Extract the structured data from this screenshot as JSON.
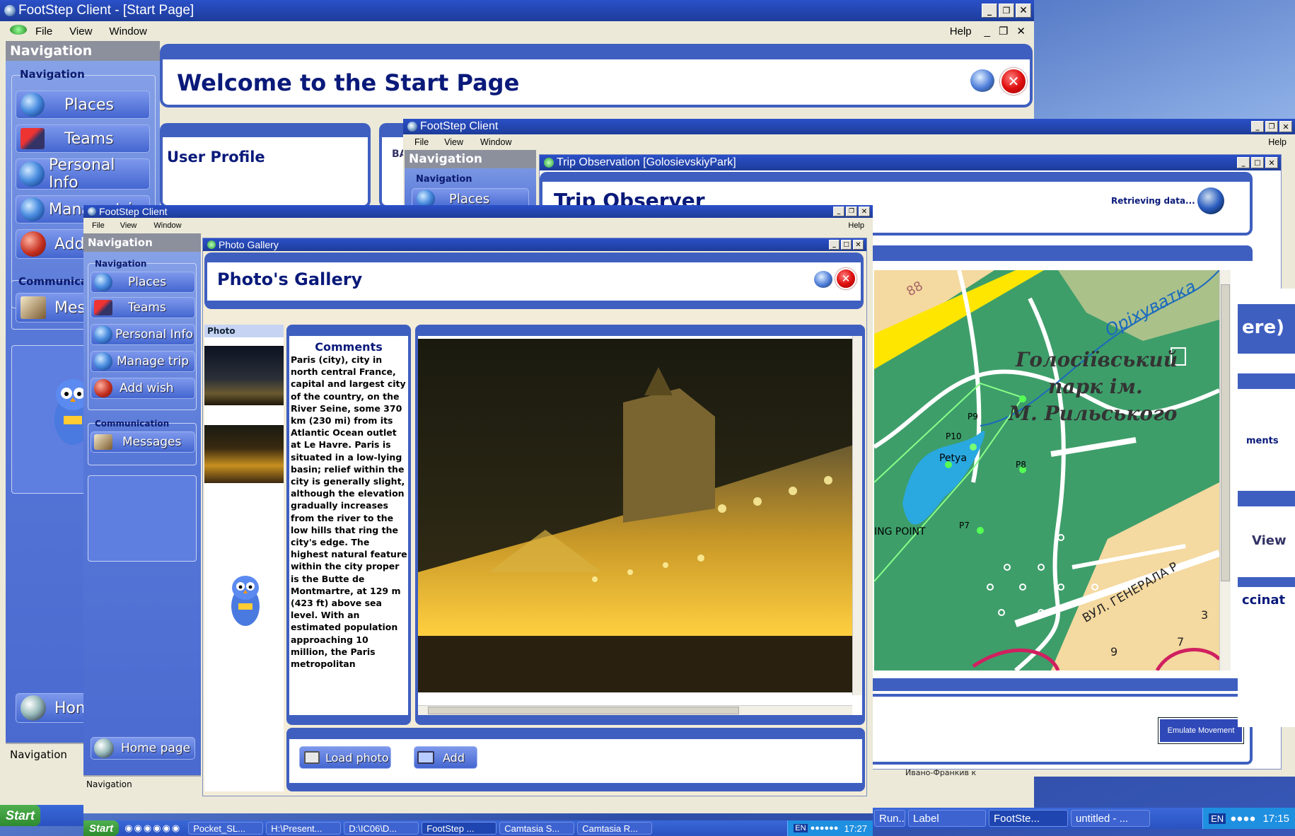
{
  "win_back": {
    "title": "FootStep Client - [Start Page]",
    "menu": [
      "File",
      "View",
      "Window"
    ],
    "help": "Help",
    "nav_header": "Navigation",
    "nav_group": "Navigation",
    "nav_items": [
      "Places",
      "Teams",
      "Personal Info",
      "Manage trip",
      "Add wish"
    ],
    "comm_group": "Communication",
    "comm_items": [
      "Messages"
    ],
    "home": "Home page",
    "nav_footer": "Navigation",
    "welcome": "Welcome to the Start Page",
    "user_profile": "User Profile",
    "tab_partial": "BA"
  },
  "win_mid": {
    "title": "FootStep Client",
    "menu": [
      "File",
      "View",
      "Window"
    ],
    "help": "Help",
    "nav_header": "Navigation",
    "nav_group": "Navigation",
    "nav_first": "Places",
    "child_title": "Trip Observation [GolosievskiyPark]",
    "heading_partial": "Trip Observer",
    "retrieving": "Retrieving data...",
    "map_labels": {
      "park_name_line1": "Голосіївський",
      "park_name_line2": "парк ім.",
      "park_name_line3": "М. Рильського",
      "river": "Оріхуватка",
      "street": "ВУЛ. ГЕНЕРАЛА Р",
      "p9": "P9",
      "p10": "P10",
      "p8": "P8",
      "p7": "P7",
      "petya": "Petya",
      "meeting": "ING POINT",
      "block88": "88",
      "block9": "9",
      "block7": "7",
      "block3": "3"
    },
    "right_partial_1": "ere)",
    "right_partial_2": "ments",
    "right_partial_3": "View",
    "right_partial_4": "ccinat",
    "emulate": "Emulate Movement",
    "bottom_partial": "Ивано-Франкив к"
  },
  "win_front": {
    "title": "FootStep Client",
    "menu": [
      "File",
      "View",
      "Window"
    ],
    "help": "Help",
    "nav_header": "Navigation",
    "nav_group": "Navigation",
    "nav_items": [
      "Places",
      "Teams",
      "Personal Info",
      "Manage trip",
      "Add wish"
    ],
    "comm_group": "Communication",
    "comm_items": [
      "Messages"
    ],
    "home": "Home page",
    "nav_footer": "Navigation",
    "child_title": "Photo Gallery",
    "heading": "Photo's Gallery",
    "photo_col": "Photo",
    "comments_title": "Comments",
    "comments_text": "Paris (city), city in north central France, capital and largest city of the country, on the River Seine, some 370 km (230 mi) from its Atlantic Ocean outlet at Le Havre. Paris is situated in a low-lying basin; relief within the city is generally slight, although the elevation gradually increases from the river to the low hills that ring the city's edge. The highest natural feature within the city proper is the Butte de Montmartre, at 129 m (423 ft) above sea level. With an estimated population approaching 10 million, the Paris metropolitan",
    "load_photo": "Load photo",
    "add": "Add"
  },
  "taskbar_back": {
    "start": "Start",
    "items": [
      "Run...",
      "Label",
      "FootSte...",
      "untitled - ..."
    ],
    "lang": "EN",
    "clock": "17:15"
  },
  "taskbar_front": {
    "start": "Start",
    "items": [
      "Pocket_SL...",
      "H:\\Present...",
      "D:\\IC06\\D...",
      "FootStep ...",
      "Camtasia S...",
      "Camtasia R..."
    ],
    "lang": "EN",
    "clock": "17:27"
  },
  "colors": {
    "titlebar": "#2b50c8",
    "nav_pane": "#5878d8",
    "panel_border": "#3f5fc0",
    "heading_text": "#0a1a7a",
    "map_green": "#3aa068"
  }
}
